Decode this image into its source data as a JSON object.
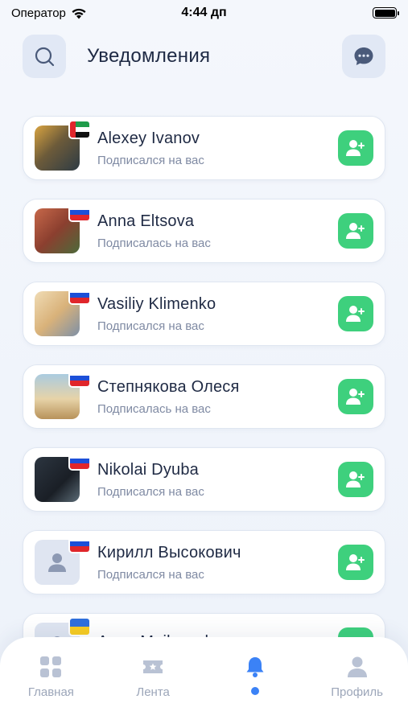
{
  "status_bar": {
    "carrier": "Оператор",
    "time": "4:44 дп"
  },
  "header": {
    "title": "Уведомления",
    "left_icon": "search-icon",
    "right_icon": "chat-bubble-icon"
  },
  "colors": {
    "accent_green": "#3ed07d",
    "accent_blue": "#3b82f6",
    "title": "#1f2a44",
    "subtitle": "#7f8aa3"
  },
  "notifications": [
    {
      "name": "Alexey Ivanov",
      "subtitle": "Подписался на вас",
      "flag": "uae",
      "avatar": "photo"
    },
    {
      "name": "Anna Eltsova",
      "subtitle": "Подписалась на вас",
      "flag": "russia",
      "avatar": "photo"
    },
    {
      "name": "Vasiliy Klimenko",
      "subtitle": "Подписался на вас",
      "flag": "russia",
      "avatar": "photo"
    },
    {
      "name": "Степнякова Олеся",
      "subtitle": "Подписалась на вас",
      "flag": "russia",
      "avatar": "photo"
    },
    {
      "name": "Nikolai Dyuba",
      "subtitle": "Подписался на вас",
      "flag": "russia",
      "avatar": "photo"
    },
    {
      "name": "Кирилл Высокович",
      "subtitle": "Подписался на вас",
      "flag": "russia",
      "avatar": "placeholder"
    },
    {
      "name": "Anna Maiboroda",
      "subtitle": "",
      "flag": "ukraine",
      "avatar": "placeholder"
    }
  ],
  "tab_bar": {
    "tabs": [
      {
        "label": "Главная",
        "icon": "grid-icon",
        "active": false
      },
      {
        "label": "Лента",
        "icon": "ticket-icon",
        "active": false
      },
      {
        "label": "",
        "icon": "bell-icon",
        "active": true
      },
      {
        "label": "Профиль",
        "icon": "user-icon",
        "active": false
      }
    ]
  }
}
